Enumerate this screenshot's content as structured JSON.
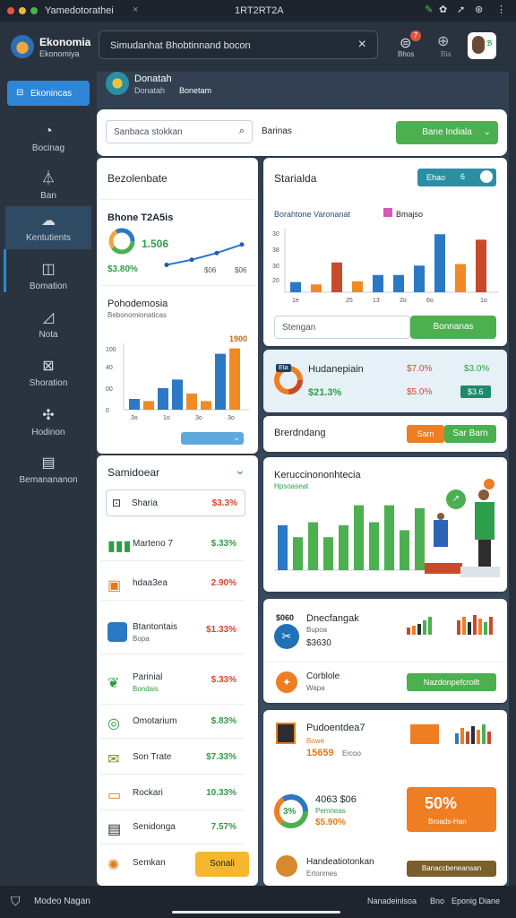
{
  "titlebar": {
    "title": "Yamedotorathei",
    "center": "1RT2RT2A",
    "colors": {
      "red": "#e95548",
      "yellow": "#e8b83a",
      "green": "#4cb24d"
    }
  },
  "app": {
    "name": "Ekonomia",
    "subtitle": "Ekonomiya"
  },
  "search": {
    "value": "Simudanhat Bhobtinnand bocon"
  },
  "profile": {
    "name": "Donatah",
    "line": "Donatah",
    "role": "Bonetam"
  },
  "notifications": {
    "count": "7",
    "label": "Bhos"
  },
  "header_icons": {
    "globe_label": "Bla"
  },
  "sidebar": {
    "active_button": "Ekonincas",
    "items": [
      {
        "label": "Bocinag",
        "icon": "compass-icon"
      },
      {
        "label": "Ban",
        "icon": "flask-icon"
      },
      {
        "label": "Kentutients",
        "icon": "cloud-icon"
      },
      {
        "label": "Bomation",
        "icon": "chart-box-icon"
      },
      {
        "label": "Nota",
        "icon": "document-icon"
      },
      {
        "label": "Shoration",
        "icon": "map-icon"
      },
      {
        "label": "Hodinon",
        "icon": "network-icon"
      },
      {
        "label": "Bemanananon",
        "icon": "table-icon"
      }
    ]
  },
  "toolbar": {
    "search_placeholder": "Sanbaca stokkan",
    "label": "Barinas",
    "dropdown": "Bane Indiala"
  },
  "left_panel": {
    "title": "Bezolenbate",
    "kpi": {
      "title": "Bhone T2A5is",
      "value": "1.506",
      "sub": "$3.80%",
      "tick1": "$06",
      "tick2": "$06"
    },
    "bars": {
      "title": "Pohodemosia",
      "subtitle": "Bebonomionaticas",
      "top_label": "1900"
    },
    "slider_label": "",
    "colors": {
      "blue": "#2b78c5",
      "orange": "#f08a24",
      "green": "#4caf50",
      "red": "#c94a2a"
    }
  },
  "right_panel": {
    "title": "Starialda",
    "toggle": {
      "label": "Ehao"
    },
    "legend": {
      "a": "Borahtone Varonanat",
      "b": "Bmajso"
    },
    "input_placeholder": "Stengan",
    "button": "Bonnanas"
  },
  "gauge_card": {
    "title": "Hudanepiain",
    "a1": "$7.0%",
    "a2": "$21.3%",
    "b1": "$3.0%",
    "b2": "$5.0%",
    "badge": "$3.6",
    "label": "Eta"
  },
  "breakdown": {
    "label": "Brerdndang",
    "btn1": "Sarn",
    "btn2": "Sar Barn"
  },
  "sidebar_list": {
    "title": "Samidoear",
    "rows": [
      {
        "label": "Sharia",
        "value": "$3.3%",
        "tone": "neg",
        "icon": "image-icon"
      },
      {
        "label": "Marteno 7",
        "value": "$.33%",
        "tone": "pos",
        "icon": "bars-icon"
      },
      {
        "label": "hdaa3ea",
        "value": "2.90%",
        "tone": "neg",
        "icon": "tag-icon"
      },
      {
        "label": "Btantontais",
        "value": "$1.33%",
        "tone": "neg",
        "icon": "app-icon",
        "sub": "Bopa"
      },
      {
        "label": "Parinial",
        "value": "$.33%",
        "tone": "neg",
        "icon": "leaf-icon",
        "sub": "Bondais"
      },
      {
        "label": "Omotarium",
        "value": "$.83%",
        "tone": "pos",
        "icon": "globe-icon"
      },
      {
        "label": "Son Trate",
        "value": "$7.33%",
        "tone": "pos",
        "icon": "mail-icon"
      },
      {
        "label": "Rockari",
        "value": "10.33%",
        "tone": "pos",
        "icon": "folder-icon"
      },
      {
        "label": "Senidonga",
        "value": "7.57%",
        "tone": "pos",
        "icon": "document-icon"
      },
      {
        "label": "Semkan",
        "value": "Sonali",
        "tone": "btn",
        "icon": "sun-icon"
      }
    ]
  },
  "people_card": {
    "title": "Keruccinononhtecia",
    "subtitle": "Hpsoaseat"
  },
  "finance_card": {
    "title": "Dnecfangak",
    "kpi": "$060",
    "sub": "Bupoa",
    "val": "$3630",
    "row_label": "Corblole",
    "row_sub": "Wapa",
    "btn": "Nazdonpefcrollt"
  },
  "bottom_card": {
    "title": "Pudoentdea7",
    "sub": "Bowe",
    "val": "15659",
    "val_sub": "Ercoo",
    "donut_label": "4063 $06",
    "donut_sub": "Pemneas",
    "donut_val": "$5.90%",
    "donut_center": "3%",
    "promo": "50%",
    "promo_sub": "Broads-Han",
    "footer_label": "Handeatiotonkan",
    "footer_sub": "Ertonmes",
    "footer_btn": "Banaccbeneansan"
  },
  "bottombar": {
    "left": "Modeo Nagan",
    "r1": "Nanadeinlsoa",
    "r2": "Bno",
    "r3": "Eponig Diane"
  },
  "chart_data": [
    {
      "type": "line",
      "title": "Bhone T2A5is",
      "x": [
        1,
        2,
        3,
        4
      ],
      "y": [
        2,
        3.5,
        5.5,
        8
      ]
    },
    {
      "type": "bar",
      "title": "Pohodemosia",
      "categories": [
        "3o",
        "1o",
        "3o",
        "3o"
      ],
      "series": [
        {
          "values": [
            10,
            8,
            20,
            28,
            15,
            8,
            52,
            57
          ]
        }
      ]
    },
    {
      "type": "bar",
      "title": "Starialda",
      "categories": [
        "1e",
        "",
        "25",
        "13",
        "2o",
        "6o",
        "",
        "1o"
      ],
      "series": [
        {
          "values": [
            13,
            10,
            38,
            14,
            22,
            22,
            34,
            74,
            36,
            67
          ],
          "colors": [
            "b",
            "o",
            "r",
            "o",
            "b",
            "b",
            "b",
            "b",
            "o",
            "r"
          ]
        }
      ],
      "ylim": [
        0,
        80
      ]
    },
    {
      "type": "bar",
      "title": "Keruccinononhtecia",
      "series": [
        {
          "values": [
            45,
            33,
            48,
            33,
            45,
            65,
            48,
            65,
            40,
            62
          ]
        }
      ]
    }
  ]
}
